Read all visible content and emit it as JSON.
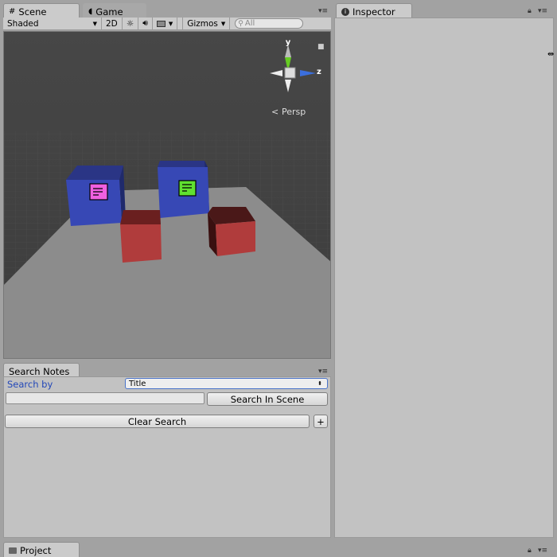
{
  "scene_tab": {
    "label": "Scene",
    "icon": "grid-icon"
  },
  "game_tab": {
    "label": "Game",
    "icon": "pacman-icon"
  },
  "inspector_tab": {
    "label": "Inspector",
    "icon": "info-icon"
  },
  "toolbar": {
    "shading_mode": "Shaded",
    "mode_2d": "2D",
    "gizmos": "Gizmos",
    "search_placeholder": "All"
  },
  "gizmo": {
    "y_label": "y",
    "z_label": "z",
    "projection": "Persp"
  },
  "search_notes": {
    "tab_label": "Search Notes",
    "search_by_label": "Search by",
    "search_by_value": "Title",
    "search_input_value": "",
    "search_button": "Search In Scene",
    "clear_button": "Clear Search",
    "add_button": "+"
  },
  "project_tab": {
    "label": "Project",
    "icon": "folder-icon"
  },
  "colors": {
    "blue_cube": "#3344b0",
    "red_cube": "#b03c3c",
    "note_pink": "#f060e0",
    "note_green": "#60e030",
    "axis_y": "#66cc22",
    "axis_z": "#3b6fdd"
  }
}
